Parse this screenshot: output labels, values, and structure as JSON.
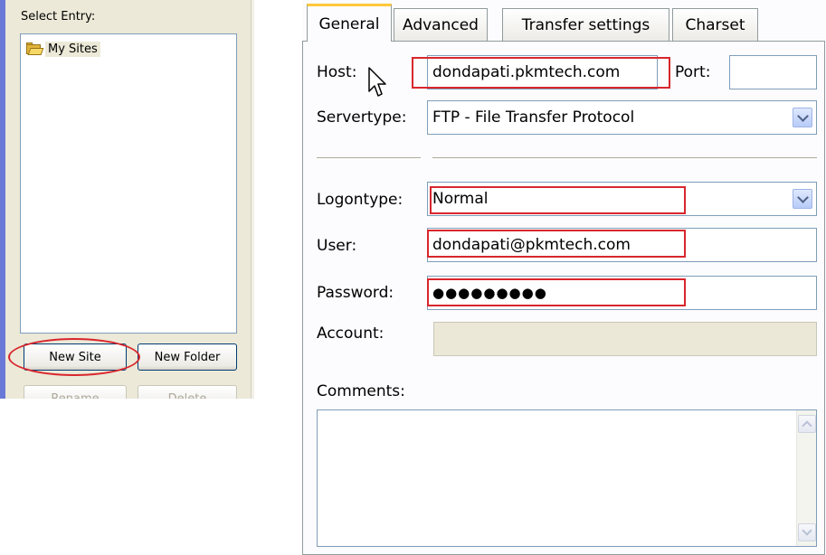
{
  "site_manager": {
    "select_entry_label": "Select Entry:",
    "tree": {
      "root_label": "My Sites"
    },
    "buttons": {
      "new_site": "New Site",
      "new_folder": "New Folder",
      "rename": "Rename",
      "delete": "Delete"
    }
  },
  "tabs": [
    "General",
    "Advanced",
    "Transfer settings",
    "Charset"
  ],
  "active_tab": "General",
  "general": {
    "host_label": "Host:",
    "host_value": "dondapati.pkmtech.com",
    "port_label": "Port:",
    "port_value": "",
    "servertype_label": "Servertype:",
    "servertype_value": "FTP - File Transfer Protocol",
    "logontype_label": "Logontype:",
    "logontype_value": "Normal",
    "user_label": "User:",
    "user_value": "dondapati@pkmtech.com",
    "password_label": "Password:",
    "password_value": "●●●●●●●●●",
    "account_label": "Account:",
    "account_value": "",
    "comments_label": "Comments:",
    "comments_value": ""
  },
  "colors": {
    "highlight_red": "#d8262c",
    "active_tab_accent": "#ffc83c",
    "panel_bg": "#ece9d8",
    "field_border": "#7f9db9"
  },
  "icons": [
    "folder-icon",
    "mouse-pointer-icon",
    "chevron-down-icon",
    "scroll-up-icon",
    "scroll-down-icon"
  ]
}
